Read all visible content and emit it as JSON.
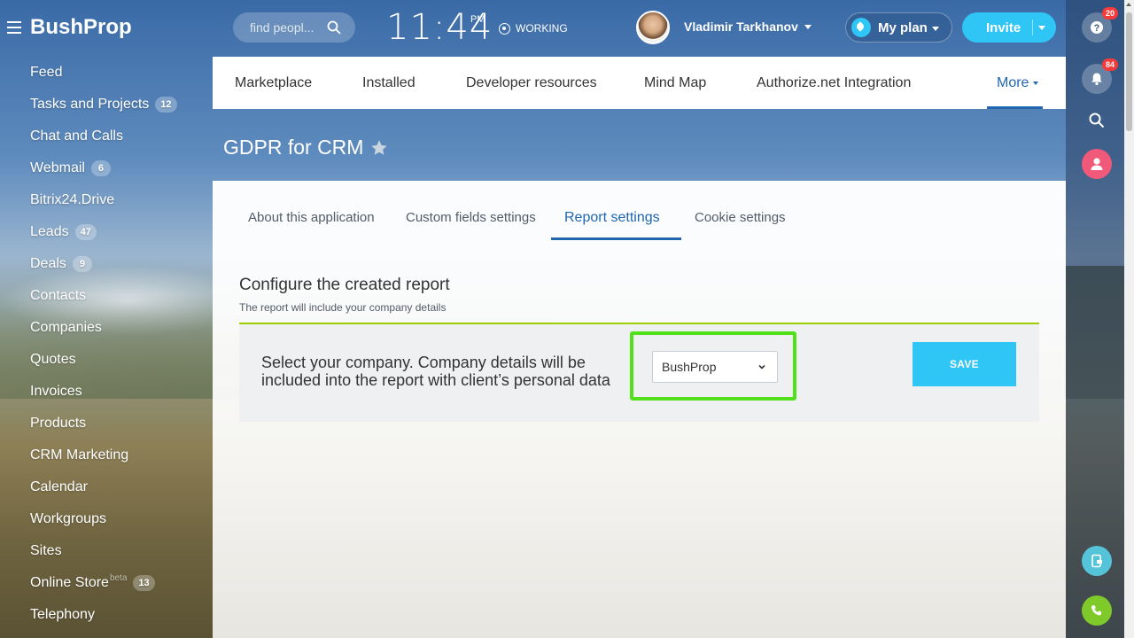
{
  "header": {
    "logo": "BushProp",
    "search_placeholder": "find peopl...",
    "clock_time": "11:44",
    "clock_ampm": "PM",
    "working_status": "WORKING",
    "user_name": "Vladimir Tarkhanov",
    "my_plan_label": "My plan",
    "invite_label": "Invite"
  },
  "left_menu": [
    {
      "label": "Feed",
      "count": null,
      "sup": null
    },
    {
      "label": "Tasks and Projects",
      "count": "12",
      "sup": null
    },
    {
      "label": "Chat and Calls",
      "count": null,
      "sup": null
    },
    {
      "label": "Webmail",
      "count": "6",
      "sup": null
    },
    {
      "label": "Bitrix24.Drive",
      "count": null,
      "sup": null
    },
    {
      "label": "Leads",
      "count": "47",
      "sup": null
    },
    {
      "label": "Deals",
      "count": "9",
      "sup": null
    },
    {
      "label": "Contacts",
      "count": null,
      "sup": null
    },
    {
      "label": "Companies",
      "count": null,
      "sup": null
    },
    {
      "label": "Quotes",
      "count": null,
      "sup": null
    },
    {
      "label": "Invoices",
      "count": null,
      "sup": null
    },
    {
      "label": "Products",
      "count": null,
      "sup": null
    },
    {
      "label": "CRM Marketing",
      "count": null,
      "sup": null
    },
    {
      "label": "Calendar",
      "count": null,
      "sup": null
    },
    {
      "label": "Workgroups",
      "count": null,
      "sup": null
    },
    {
      "label": "Sites",
      "count": null,
      "sup": null
    },
    {
      "label": "Online Store",
      "count": "13",
      "sup": "beta"
    },
    {
      "label": "Telephony",
      "count": null,
      "sup": null
    }
  ],
  "top_tabs": {
    "marketplace": "Marketplace",
    "installed": "Installed",
    "developer": "Developer resources",
    "mindmap": "Mind Map",
    "authorize": "Authorize.net Integration",
    "more": "More"
  },
  "page_title": "GDPR for CRM",
  "sub_tabs": {
    "about": "About this application",
    "custom": "Custom fields settings",
    "report": "Report settings",
    "cookie": "Cookie settings"
  },
  "report": {
    "title": "Configure the created report",
    "subtitle": "The report will include your company details",
    "select_label": "Select your company. Company details will be included into the report with client’s personal data",
    "company_value": "BushProp",
    "save_label": "SAVE"
  },
  "right_bar": {
    "help_badge": "20",
    "notifications_badge": "84"
  },
  "colors": {
    "accent_blue": "#2067b0",
    "button_cyan": "#2fc6f6",
    "highlight_green": "#52e01a",
    "section_line": "#9dcf00"
  }
}
